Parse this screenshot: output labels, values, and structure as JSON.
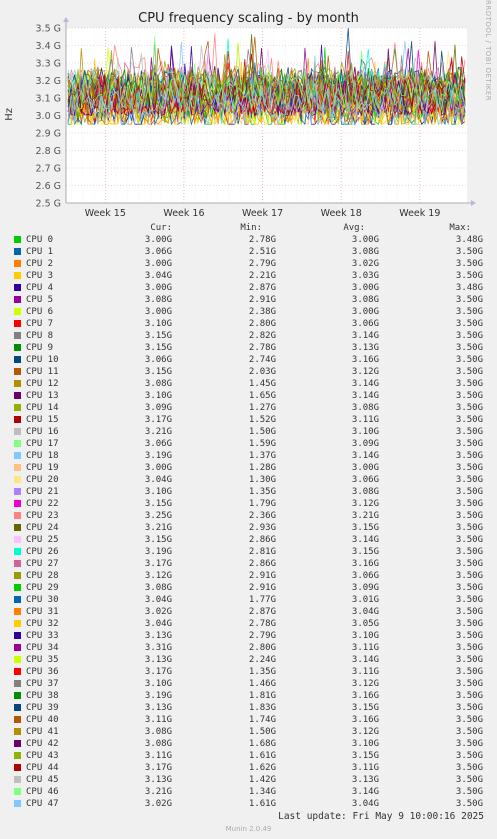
{
  "chart_data": {
    "type": "line",
    "title": "CPU frequency scaling - by month",
    "ylabel": "Hz",
    "side_label": "RRDTOOL / TOBI OETIKER",
    "y_ticks": [
      "3.5 G",
      "3.4 G",
      "3.3 G",
      "3.2 G",
      "3.1 G",
      "3.0 G",
      "2.9 G",
      "2.8 G",
      "2.7 G",
      "2.6 G",
      "2.5 G"
    ],
    "ylim": [
      2.5,
      3.5
    ],
    "x_ticks": [
      "Week 15",
      "Week 16",
      "Week 17",
      "Week 18",
      "Week 19"
    ],
    "grid": true,
    "legend_headers": {
      "cur": "Cur:",
      "min": "Min:",
      "avg": "Avg:",
      "max": "Max:"
    },
    "series": [
      {
        "name": "CPU 0",
        "color": "#00cc00",
        "cur": "3.00G",
        "min": "2.78G",
        "avg": "3.00G",
        "max": "3.48G"
      },
      {
        "name": "CPU 1",
        "color": "#0066b3",
        "cur": "3.06G",
        "min": "2.51G",
        "avg": "3.08G",
        "max": "3.50G"
      },
      {
        "name": "CPU 2",
        "color": "#ff8000",
        "cur": "3.00G",
        "min": "2.79G",
        "avg": "3.02G",
        "max": "3.50G"
      },
      {
        "name": "CPU 3",
        "color": "#ffcc00",
        "cur": "3.04G",
        "min": "2.21G",
        "avg": "3.03G",
        "max": "3.50G"
      },
      {
        "name": "CPU 4",
        "color": "#330099",
        "cur": "3.00G",
        "min": "2.87G",
        "avg": "3.00G",
        "max": "3.48G"
      },
      {
        "name": "CPU 5",
        "color": "#990099",
        "cur": "3.08G",
        "min": "2.91G",
        "avg": "3.08G",
        "max": "3.50G"
      },
      {
        "name": "CPU 6",
        "color": "#ccff00",
        "cur": "3.00G",
        "min": "2.38G",
        "avg": "3.00G",
        "max": "3.50G"
      },
      {
        "name": "CPU 7",
        "color": "#ff0000",
        "cur": "3.10G",
        "min": "2.80G",
        "avg": "3.06G",
        "max": "3.50G"
      },
      {
        "name": "CPU 8",
        "color": "#808080",
        "cur": "3.15G",
        "min": "2.82G",
        "avg": "3.14G",
        "max": "3.50G"
      },
      {
        "name": "CPU 9",
        "color": "#008f00",
        "cur": "3.15G",
        "min": "2.78G",
        "avg": "3.13G",
        "max": "3.50G"
      },
      {
        "name": "CPU 10",
        "color": "#00487d",
        "cur": "3.06G",
        "min": "2.74G",
        "avg": "3.16G",
        "max": "3.50G"
      },
      {
        "name": "CPU 11",
        "color": "#b35a00",
        "cur": "3.15G",
        "min": "2.03G",
        "avg": "3.12G",
        "max": "3.50G"
      },
      {
        "name": "CPU 12",
        "color": "#b38f00",
        "cur": "3.08G",
        "min": "1.45G",
        "avg": "3.14G",
        "max": "3.50G"
      },
      {
        "name": "CPU 13",
        "color": "#6b006b",
        "cur": "3.10G",
        "min": "1.65G",
        "avg": "3.14G",
        "max": "3.50G"
      },
      {
        "name": "CPU 14",
        "color": "#8fb300",
        "cur": "3.09G",
        "min": "1.27G",
        "avg": "3.08G",
        "max": "3.50G"
      },
      {
        "name": "CPU 15",
        "color": "#b30000",
        "cur": "3.17G",
        "min": "1.52G",
        "avg": "3.11G",
        "max": "3.50G"
      },
      {
        "name": "CPU 16",
        "color": "#bebebe",
        "cur": "3.21G",
        "min": "1.50G",
        "avg": "3.10G",
        "max": "3.50G"
      },
      {
        "name": "CPU 17",
        "color": "#80ff80",
        "cur": "3.06G",
        "min": "1.59G",
        "avg": "3.09G",
        "max": "3.50G"
      },
      {
        "name": "CPU 18",
        "color": "#80c9ff",
        "cur": "3.19G",
        "min": "1.37G",
        "avg": "3.14G",
        "max": "3.50G"
      },
      {
        "name": "CPU 19",
        "color": "#ffc080",
        "cur": "3.00G",
        "min": "1.28G",
        "avg": "3.00G",
        "max": "3.50G"
      },
      {
        "name": "CPU 20",
        "color": "#ffe680",
        "cur": "3.04G",
        "min": "1.30G",
        "avg": "3.06G",
        "max": "3.50G"
      },
      {
        "name": "CPU 21",
        "color": "#aa80ff",
        "cur": "3.10G",
        "min": "1.35G",
        "avg": "3.08G",
        "max": "3.50G"
      },
      {
        "name": "CPU 22",
        "color": "#ee00cc",
        "cur": "3.15G",
        "min": "1.79G",
        "avg": "3.12G",
        "max": "3.50G"
      },
      {
        "name": "CPU 23",
        "color": "#ff8080",
        "cur": "3.25G",
        "min": "2.36G",
        "avg": "3.21G",
        "max": "3.50G"
      },
      {
        "name": "CPU 24",
        "color": "#666600",
        "cur": "3.21G",
        "min": "2.93G",
        "avg": "3.15G",
        "max": "3.50G"
      },
      {
        "name": "CPU 25",
        "color": "#ffbfff",
        "cur": "3.15G",
        "min": "2.86G",
        "avg": "3.14G",
        "max": "3.50G"
      },
      {
        "name": "CPU 26",
        "color": "#00ffcc",
        "cur": "3.19G",
        "min": "2.81G",
        "avg": "3.15G",
        "max": "3.50G"
      },
      {
        "name": "CPU 27",
        "color": "#cc6699",
        "cur": "3.17G",
        "min": "2.86G",
        "avg": "3.16G",
        "max": "3.50G"
      },
      {
        "name": "CPU 28",
        "color": "#999900",
        "cur": "3.12G",
        "min": "2.91G",
        "avg": "3.06G",
        "max": "3.50G"
      },
      {
        "name": "CPU 29",
        "color": "#00cc00",
        "cur": "3.08G",
        "min": "2.91G",
        "avg": "3.09G",
        "max": "3.50G"
      },
      {
        "name": "CPU 30",
        "color": "#0066b3",
        "cur": "3.04G",
        "min": "1.77G",
        "avg": "3.01G",
        "max": "3.50G"
      },
      {
        "name": "CPU 31",
        "color": "#ff8000",
        "cur": "3.02G",
        "min": "2.87G",
        "avg": "3.04G",
        "max": "3.50G"
      },
      {
        "name": "CPU 32",
        "color": "#ffcc00",
        "cur": "3.04G",
        "min": "2.78G",
        "avg": "3.05G",
        "max": "3.50G"
      },
      {
        "name": "CPU 33",
        "color": "#330099",
        "cur": "3.13G",
        "min": "2.79G",
        "avg": "3.10G",
        "max": "3.50G"
      },
      {
        "name": "CPU 34",
        "color": "#990099",
        "cur": "3.31G",
        "min": "2.80G",
        "avg": "3.11G",
        "max": "3.50G"
      },
      {
        "name": "CPU 35",
        "color": "#ccff00",
        "cur": "3.13G",
        "min": "2.24G",
        "avg": "3.14G",
        "max": "3.50G"
      },
      {
        "name": "CPU 36",
        "color": "#ff0000",
        "cur": "3.17G",
        "min": "1.35G",
        "avg": "3.11G",
        "max": "3.50G"
      },
      {
        "name": "CPU 37",
        "color": "#808080",
        "cur": "3.10G",
        "min": "1.46G",
        "avg": "3.12G",
        "max": "3.50G"
      },
      {
        "name": "CPU 38",
        "color": "#008f00",
        "cur": "3.19G",
        "min": "1.81G",
        "avg": "3.16G",
        "max": "3.50G"
      },
      {
        "name": "CPU 39",
        "color": "#00487d",
        "cur": "3.13G",
        "min": "1.83G",
        "avg": "3.15G",
        "max": "3.50G"
      },
      {
        "name": "CPU 40",
        "color": "#b35a00",
        "cur": "3.11G",
        "min": "1.74G",
        "avg": "3.16G",
        "max": "3.50G"
      },
      {
        "name": "CPU 41",
        "color": "#b38f00",
        "cur": "3.08G",
        "min": "1.50G",
        "avg": "3.12G",
        "max": "3.50G"
      },
      {
        "name": "CPU 42",
        "color": "#6b006b",
        "cur": "3.08G",
        "min": "1.68G",
        "avg": "3.10G",
        "max": "3.50G"
      },
      {
        "name": "CPU 43",
        "color": "#8fb300",
        "cur": "3.11G",
        "min": "1.61G",
        "avg": "3.15G",
        "max": "3.50G"
      },
      {
        "name": "CPU 44",
        "color": "#b30000",
        "cur": "3.17G",
        "min": "1.62G",
        "avg": "3.11G",
        "max": "3.50G"
      },
      {
        "name": "CPU 45",
        "color": "#bebebe",
        "cur": "3.13G",
        "min": "1.42G",
        "avg": "3.13G",
        "max": "3.50G"
      },
      {
        "name": "CPU 46",
        "color": "#80ff80",
        "cur": "3.21G",
        "min": "1.34G",
        "avg": "3.14G",
        "max": "3.50G"
      },
      {
        "name": "CPU 47",
        "color": "#80c9ff",
        "cur": "3.02G",
        "min": "1.61G",
        "avg": "3.04G",
        "max": "3.50G"
      }
    ]
  },
  "footer": {
    "last_update": "Last update: Fri May  9 10:00:16 2025",
    "version": "Munin 2.0.49"
  }
}
